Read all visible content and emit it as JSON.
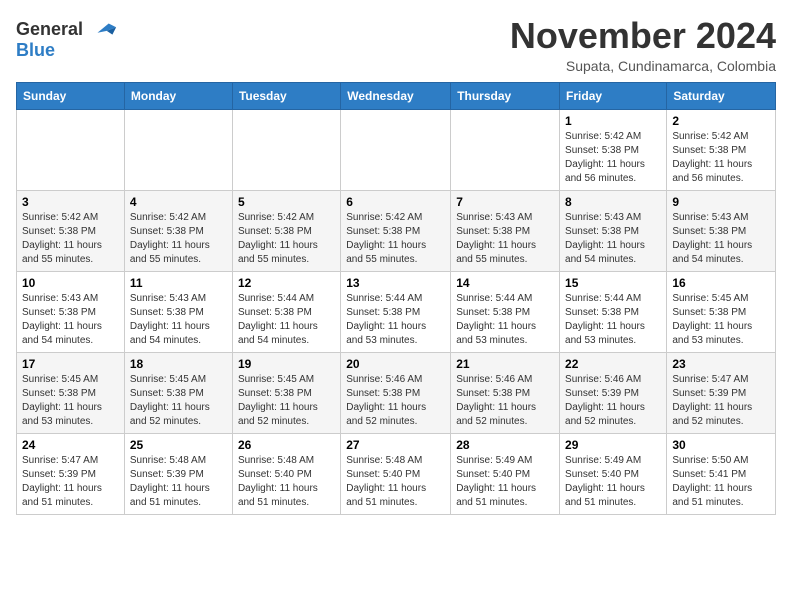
{
  "header": {
    "logo": {
      "line1": "General",
      "line2": "Blue"
    },
    "title": "November 2024",
    "location": "Supata, Cundinamarca, Colombia"
  },
  "weekdays": [
    "Sunday",
    "Monday",
    "Tuesday",
    "Wednesday",
    "Thursday",
    "Friday",
    "Saturday"
  ],
  "weeks": [
    [
      {
        "day": "",
        "info": ""
      },
      {
        "day": "",
        "info": ""
      },
      {
        "day": "",
        "info": ""
      },
      {
        "day": "",
        "info": ""
      },
      {
        "day": "",
        "info": ""
      },
      {
        "day": "1",
        "info": "Sunrise: 5:42 AM\nSunset: 5:38 PM\nDaylight: 11 hours\nand 56 minutes."
      },
      {
        "day": "2",
        "info": "Sunrise: 5:42 AM\nSunset: 5:38 PM\nDaylight: 11 hours\nand 56 minutes."
      }
    ],
    [
      {
        "day": "3",
        "info": "Sunrise: 5:42 AM\nSunset: 5:38 PM\nDaylight: 11 hours\nand 55 minutes."
      },
      {
        "day": "4",
        "info": "Sunrise: 5:42 AM\nSunset: 5:38 PM\nDaylight: 11 hours\nand 55 minutes."
      },
      {
        "day": "5",
        "info": "Sunrise: 5:42 AM\nSunset: 5:38 PM\nDaylight: 11 hours\nand 55 minutes."
      },
      {
        "day": "6",
        "info": "Sunrise: 5:42 AM\nSunset: 5:38 PM\nDaylight: 11 hours\nand 55 minutes."
      },
      {
        "day": "7",
        "info": "Sunrise: 5:43 AM\nSunset: 5:38 PM\nDaylight: 11 hours\nand 55 minutes."
      },
      {
        "day": "8",
        "info": "Sunrise: 5:43 AM\nSunset: 5:38 PM\nDaylight: 11 hours\nand 54 minutes."
      },
      {
        "day": "9",
        "info": "Sunrise: 5:43 AM\nSunset: 5:38 PM\nDaylight: 11 hours\nand 54 minutes."
      }
    ],
    [
      {
        "day": "10",
        "info": "Sunrise: 5:43 AM\nSunset: 5:38 PM\nDaylight: 11 hours\nand 54 minutes."
      },
      {
        "day": "11",
        "info": "Sunrise: 5:43 AM\nSunset: 5:38 PM\nDaylight: 11 hours\nand 54 minutes."
      },
      {
        "day": "12",
        "info": "Sunrise: 5:44 AM\nSunset: 5:38 PM\nDaylight: 11 hours\nand 54 minutes."
      },
      {
        "day": "13",
        "info": "Sunrise: 5:44 AM\nSunset: 5:38 PM\nDaylight: 11 hours\nand 53 minutes."
      },
      {
        "day": "14",
        "info": "Sunrise: 5:44 AM\nSunset: 5:38 PM\nDaylight: 11 hours\nand 53 minutes."
      },
      {
        "day": "15",
        "info": "Sunrise: 5:44 AM\nSunset: 5:38 PM\nDaylight: 11 hours\nand 53 minutes."
      },
      {
        "day": "16",
        "info": "Sunrise: 5:45 AM\nSunset: 5:38 PM\nDaylight: 11 hours\nand 53 minutes."
      }
    ],
    [
      {
        "day": "17",
        "info": "Sunrise: 5:45 AM\nSunset: 5:38 PM\nDaylight: 11 hours\nand 53 minutes."
      },
      {
        "day": "18",
        "info": "Sunrise: 5:45 AM\nSunset: 5:38 PM\nDaylight: 11 hours\nand 52 minutes."
      },
      {
        "day": "19",
        "info": "Sunrise: 5:45 AM\nSunset: 5:38 PM\nDaylight: 11 hours\nand 52 minutes."
      },
      {
        "day": "20",
        "info": "Sunrise: 5:46 AM\nSunset: 5:38 PM\nDaylight: 11 hours\nand 52 minutes."
      },
      {
        "day": "21",
        "info": "Sunrise: 5:46 AM\nSunset: 5:38 PM\nDaylight: 11 hours\nand 52 minutes."
      },
      {
        "day": "22",
        "info": "Sunrise: 5:46 AM\nSunset: 5:39 PM\nDaylight: 11 hours\nand 52 minutes."
      },
      {
        "day": "23",
        "info": "Sunrise: 5:47 AM\nSunset: 5:39 PM\nDaylight: 11 hours\nand 52 minutes."
      }
    ],
    [
      {
        "day": "24",
        "info": "Sunrise: 5:47 AM\nSunset: 5:39 PM\nDaylight: 11 hours\nand 51 minutes."
      },
      {
        "day": "25",
        "info": "Sunrise: 5:48 AM\nSunset: 5:39 PM\nDaylight: 11 hours\nand 51 minutes."
      },
      {
        "day": "26",
        "info": "Sunrise: 5:48 AM\nSunset: 5:40 PM\nDaylight: 11 hours\nand 51 minutes."
      },
      {
        "day": "27",
        "info": "Sunrise: 5:48 AM\nSunset: 5:40 PM\nDaylight: 11 hours\nand 51 minutes."
      },
      {
        "day": "28",
        "info": "Sunrise: 5:49 AM\nSunset: 5:40 PM\nDaylight: 11 hours\nand 51 minutes."
      },
      {
        "day": "29",
        "info": "Sunrise: 5:49 AM\nSunset: 5:40 PM\nDaylight: 11 hours\nand 51 minutes."
      },
      {
        "day": "30",
        "info": "Sunrise: 5:50 AM\nSunset: 5:41 PM\nDaylight: 11 hours\nand 51 minutes."
      }
    ]
  ]
}
